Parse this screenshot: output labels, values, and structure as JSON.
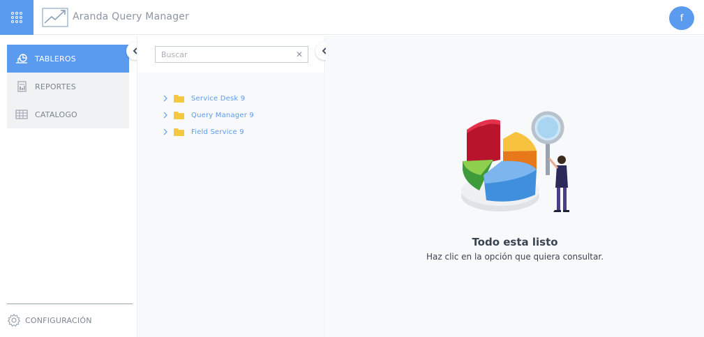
{
  "header": {
    "app_title": "Aranda Query Manager",
    "avatar_letter": "f",
    "accent_color": "#5b9bef"
  },
  "sidebar": {
    "items": [
      {
        "label": "TABLEROS",
        "icon": "dashboard-icon",
        "active": true
      },
      {
        "label": "REPORTES",
        "icon": "report-icon",
        "active": false
      },
      {
        "label": "CATALOGO",
        "icon": "catalog-icon",
        "active": false
      }
    ],
    "config_label": "CONFIGURACIÓN"
  },
  "tree": {
    "search_placeholder": "Buscar",
    "clear_symbol": "✕",
    "items": [
      {
        "label": "Service Desk 9"
      },
      {
        "label": "Query Manager 9"
      },
      {
        "label": "Field Service 9"
      }
    ]
  },
  "main": {
    "empty_title": "Todo esta listo",
    "empty_subtitle": "Haz clic en la opción que quiera consultar."
  }
}
